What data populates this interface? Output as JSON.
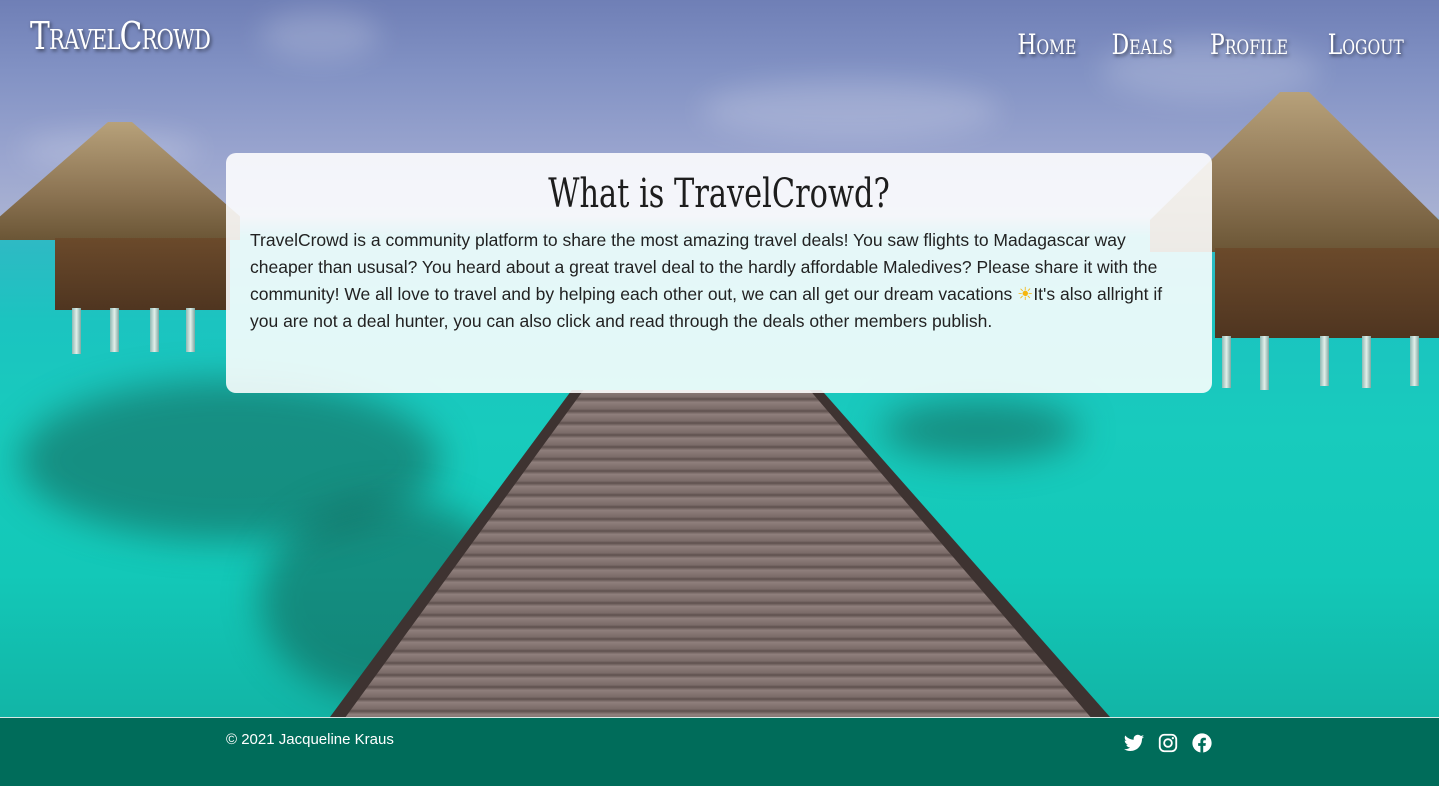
{
  "header": {
    "brand": "TravelCrowd",
    "nav": [
      {
        "label": "Home"
      },
      {
        "label": "Deals"
      },
      {
        "label": "Profile"
      },
      {
        "label": "Logout"
      }
    ]
  },
  "about": {
    "title": "What is TravelCrowd?",
    "text": "TravelCrowd is a community platform to share the most amazing travel deals! You saw flights to Madagascar way cheaper than ususal? You heard about a great travel deal to the hardly affordable Maledives? Please share it with the community! We all love to travel and by helping each other out, we can all get our dream vacations ",
    "sun_emoji": "☀",
    "text_after": "It's also allright if you are not a deal hunter, you can also click and read through the deals other members publish."
  },
  "footer": {
    "copyright": "© 2021 Jacqueline Kraus",
    "social": [
      {
        "icon": "twitter-icon"
      },
      {
        "icon": "instagram-icon"
      },
      {
        "icon": "facebook-icon"
      }
    ],
    "background_color": "#006c5a"
  }
}
